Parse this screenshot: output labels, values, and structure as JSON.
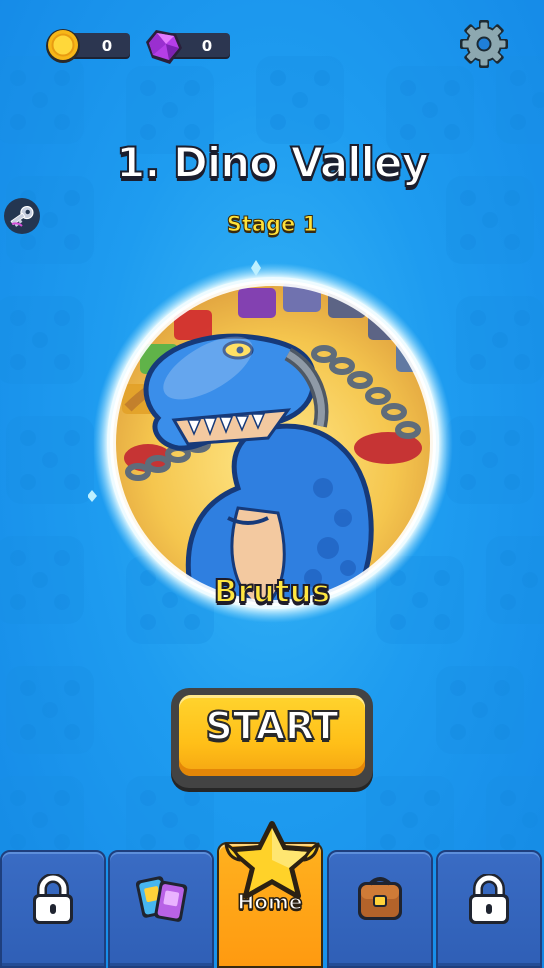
{
  "hud": {
    "coins": "0",
    "gems": "0",
    "coin_icon": "gold-coin-icon",
    "gem_icon": "purple-gem-icon",
    "settings_icon": "gear-icon",
    "key_icon": "key-icon"
  },
  "level": {
    "title": "1. Dino Valley",
    "stage": "Stage 1",
    "boss_name": "Brutus"
  },
  "start_button": {
    "label": "START"
  },
  "nav": {
    "tabs": [
      {
        "icon": "lock-icon",
        "locked": true
      },
      {
        "icon": "cards-icon",
        "locked": false
      },
      {
        "icon": "star-icon",
        "label": "Home",
        "active": true
      },
      {
        "icon": "backpack-icon",
        "locked": false
      },
      {
        "icon": "lock-icon",
        "locked": true
      }
    ],
    "home_label": "Home"
  },
  "colors": {
    "background": "#1e9cf0",
    "title_yellow": "#ffe23a",
    "start_button": "#ffc21e",
    "nav_blue": "#3366bf",
    "nav_active": "#ffa617",
    "dino_blue": "#2f7fe0"
  }
}
